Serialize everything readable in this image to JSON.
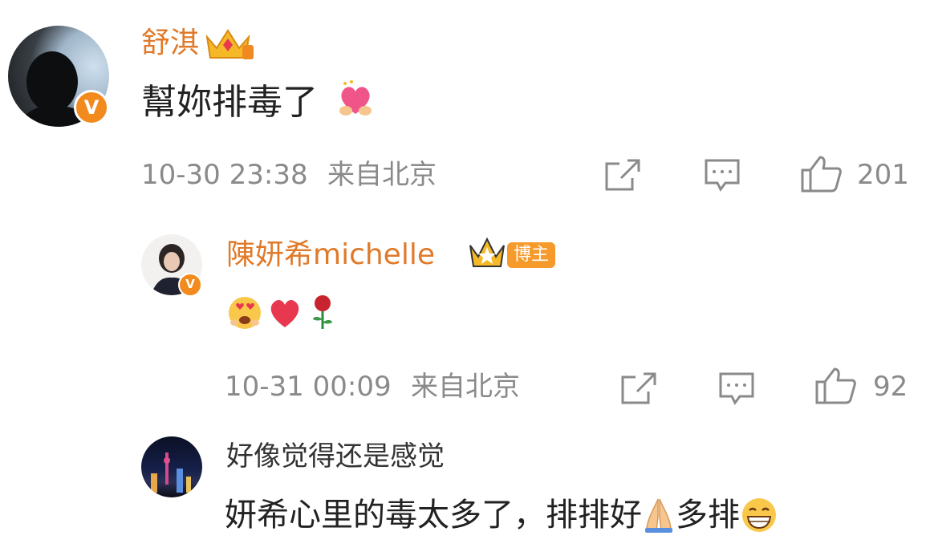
{
  "comment": {
    "username": "舒淇",
    "text": "幫妳排毒了",
    "timestamp": "10-30 23:38",
    "location": "来自北京",
    "like_count": "201",
    "verified_badge": "V",
    "icons": {
      "share": "share-icon",
      "reply": "comment-icon",
      "like": "thumbs-up-icon",
      "crown": "crown-badge-icon",
      "heart": "heart-hands-emoji"
    }
  },
  "reply": {
    "username": "陳妍希michelle",
    "author_tag": "博主",
    "timestamp": "10-31 00:09",
    "location": "来自北京",
    "like_count": "92",
    "verified_badge": "V",
    "emojis": [
      "heart-eyes-emoji",
      "red-heart-emoji",
      "rose-emoji"
    ]
  },
  "sub_comment": {
    "username": "好像觉得还是感觉",
    "text_part1": "妍希心里的毒太多了，排排好",
    "text_part2": "多排",
    "emojis": [
      "pray-emoji",
      "grin-emoji"
    ]
  },
  "colors": {
    "name": "#e07a2a",
    "meta": "#8a8a8a",
    "badge": "#f28a1e",
    "heart": "#e8384f"
  }
}
